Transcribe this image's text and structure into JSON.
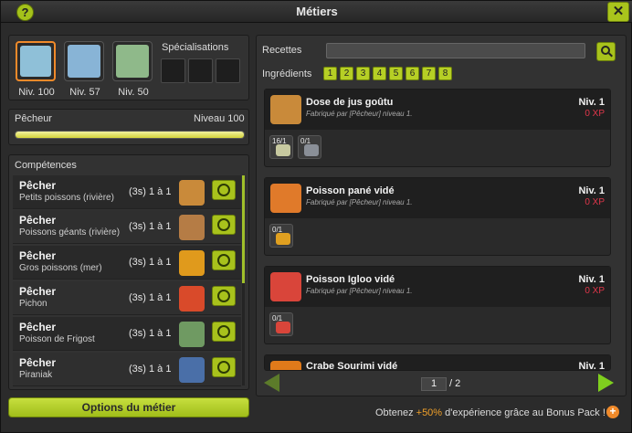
{
  "window": {
    "title": "Métiers",
    "help": "?",
    "close": "✕"
  },
  "jobs": [
    {
      "level": "Niv. 100",
      "color": "#8fc0d8",
      "active": true
    },
    {
      "level": "Niv. 57",
      "color": "#88b4d6",
      "active": false
    },
    {
      "level": "Niv. 50",
      "color": "#8fb98a",
      "active": false
    }
  ],
  "specialisations": {
    "label": "Spécialisations"
  },
  "current_job": {
    "name": "Pêcheur",
    "level": "Niveau 100",
    "progress": 1.0
  },
  "competences": {
    "title": "Compétences",
    "rows": [
      {
        "name": "Pêcher",
        "sub": "Petits poissons (rivière)",
        "range": "(3s) 1 à 1",
        "color": "#c98a3a"
      },
      {
        "name": "Pêcher",
        "sub": "Poissons géants (rivière)",
        "range": "(3s) 1 à 1",
        "color": "#b57c45"
      },
      {
        "name": "Pêcher",
        "sub": "Gros poissons (mer)",
        "range": "(3s) 1 à 1",
        "color": "#e09a1c"
      },
      {
        "name": "Pêcher",
        "sub": "Pichon",
        "range": "(3s) 1 à 1",
        "color": "#d94a2a"
      },
      {
        "name": "Pêcher",
        "sub": "Poisson de Frigost",
        "range": "(3s) 1 à 1",
        "color": "#6f9a62"
      },
      {
        "name": "Pêcher",
        "sub": "Piraniak",
        "range": "(3s) 1 à 1",
        "color": "#4a6fa8"
      }
    ],
    "options_button": "Options du métier"
  },
  "recipes_panel": {
    "recettes_label": "Recettes",
    "ingredients_label": "Ingrédients",
    "levels": [
      "1",
      "2",
      "3",
      "4",
      "5",
      "6",
      "7",
      "8"
    ],
    "recipes": [
      {
        "name": "Dose de jus goûtu",
        "made_by": "Fabriqué par [Pêcheur] niveau 1.",
        "level": "Niv. 1",
        "xp": "0 XP",
        "color": "#c98a3a",
        "ingredients": [
          {
            "qty": "16/1",
            "color": "#c7c9a0"
          },
          {
            "qty": "0/1",
            "color": "#8a8f97"
          }
        ]
      },
      {
        "name": "Poisson pané vidé",
        "made_by": "Fabriqué par [Pêcheur] niveau 1.",
        "level": "Niv. 1",
        "xp": "0 XP",
        "color": "#e07a2a",
        "ingredients": [
          {
            "qty": "0/1",
            "color": "#e0a020"
          }
        ]
      },
      {
        "name": "Poisson Igloo vidé",
        "made_by": "Fabriqué par [Pêcheur] niveau 1.",
        "level": "Niv. 1",
        "xp": "0 XP",
        "color": "#d9453a",
        "ingredients": [
          {
            "qty": "0/1",
            "color": "#d9453a"
          }
        ]
      },
      {
        "name": "Crabe Sourimi vidé",
        "level": "Niv. 1",
        "color": "#e07a1a"
      }
    ],
    "page": "1",
    "page_total": "/ 2"
  },
  "bonus": {
    "prefix": "Obtenez ",
    "highlight": "+50%",
    "suffix": " d'expérience grâce au Bonus Pack !"
  }
}
